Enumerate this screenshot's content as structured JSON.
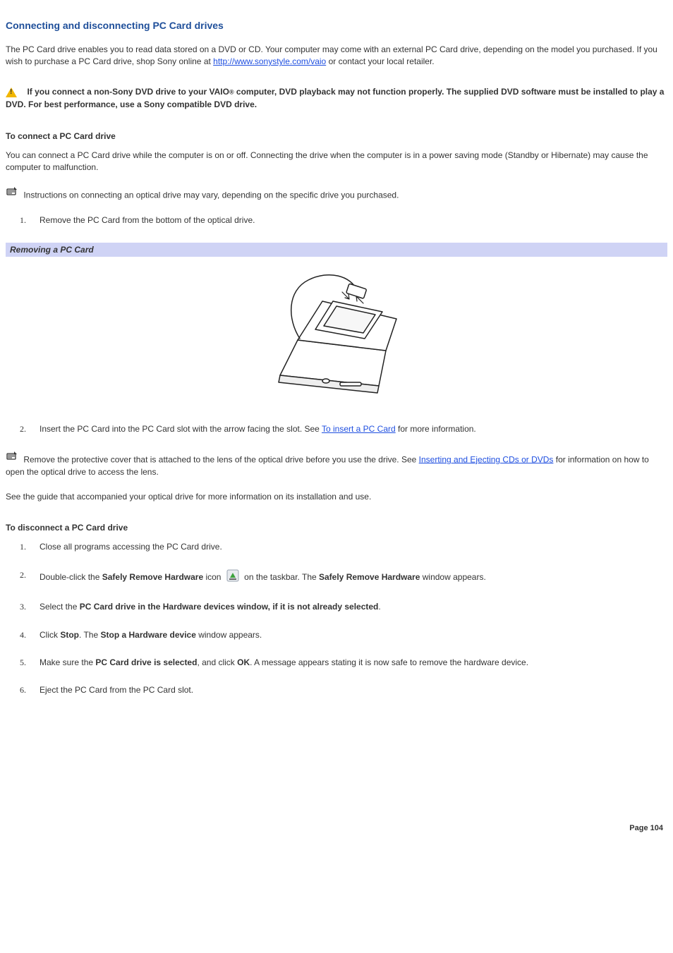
{
  "title": "Connecting and disconnecting PC Card drives",
  "intro": {
    "p1a": "The PC Card drive enables you to read data stored on a DVD or CD. Your computer may come with an external PC Card drive, depending on the model you purchased. If you wish to purchase a PC Card drive, shop Sony online at ",
    "link1_text": "http://www.sonystyle.com/vaio",
    "p1b": " or contact your local retailer."
  },
  "warning": {
    "part1": "If you connect a non-Sony DVD drive to your VAIO",
    "reg": "®",
    "part2": " computer, DVD playback may not function properly. The supplied DVD software must be installed to play a DVD. For best performance, use a Sony compatible DVD drive."
  },
  "connect": {
    "heading": "To connect a PC Card drive",
    "p1": "You can connect a PC Card drive while the computer is on or off. Connecting the drive when the computer is in a power saving mode (Standby or Hibernate) may cause the computer to malfunction.",
    "note1": "Instructions on connecting an optical drive may vary, depending on the specific drive you purchased.",
    "step1": "Remove the PC Card from the bottom of the optical drive.",
    "banner": "Removing a PC Card",
    "step2a": "Insert the PC Card into the PC Card slot with the arrow facing the slot. See ",
    "step2_link": "To insert a PC Card",
    "step2b": " for more information.",
    "note2a": "Remove the protective cover that is attached to the lens of the optical drive before you use the drive. See ",
    "note2_link": "Inserting and Ejecting CDs or DVDs",
    "note2b": " for information on how to open the optical drive to access the lens.",
    "p2": "See the guide that accompanied your optical drive for more information on its installation and use."
  },
  "disconnect": {
    "heading": "To disconnect a PC Card drive",
    "step1": "Close all programs accessing the PC Card drive.",
    "step2a": "Double-click the ",
    "step2b": "Safely Remove Hardware",
    "step2c": " icon ",
    "step2d": " on the taskbar. The ",
    "step2e": "Safely Remove Hardware",
    "step2f": " window appears.",
    "step3a": "Select the ",
    "step3b": "PC Card drive in the Hardware devices window, if it is not already selected",
    "step3c": ".",
    "step4a": "Click ",
    "step4b": "Stop",
    "step4c": ". The ",
    "step4d": "Stop a Hardware device",
    "step4e": " window appears.",
    "step5a": "Make sure the ",
    "step5b": "PC Card drive is selected",
    "step5c": ", and click ",
    "step5d": "OK",
    "step5e": ". A message appears stating it is now safe to remove the hardware device.",
    "step6": "Eject the PC Card from the PC Card slot."
  },
  "footer": "Page 104"
}
